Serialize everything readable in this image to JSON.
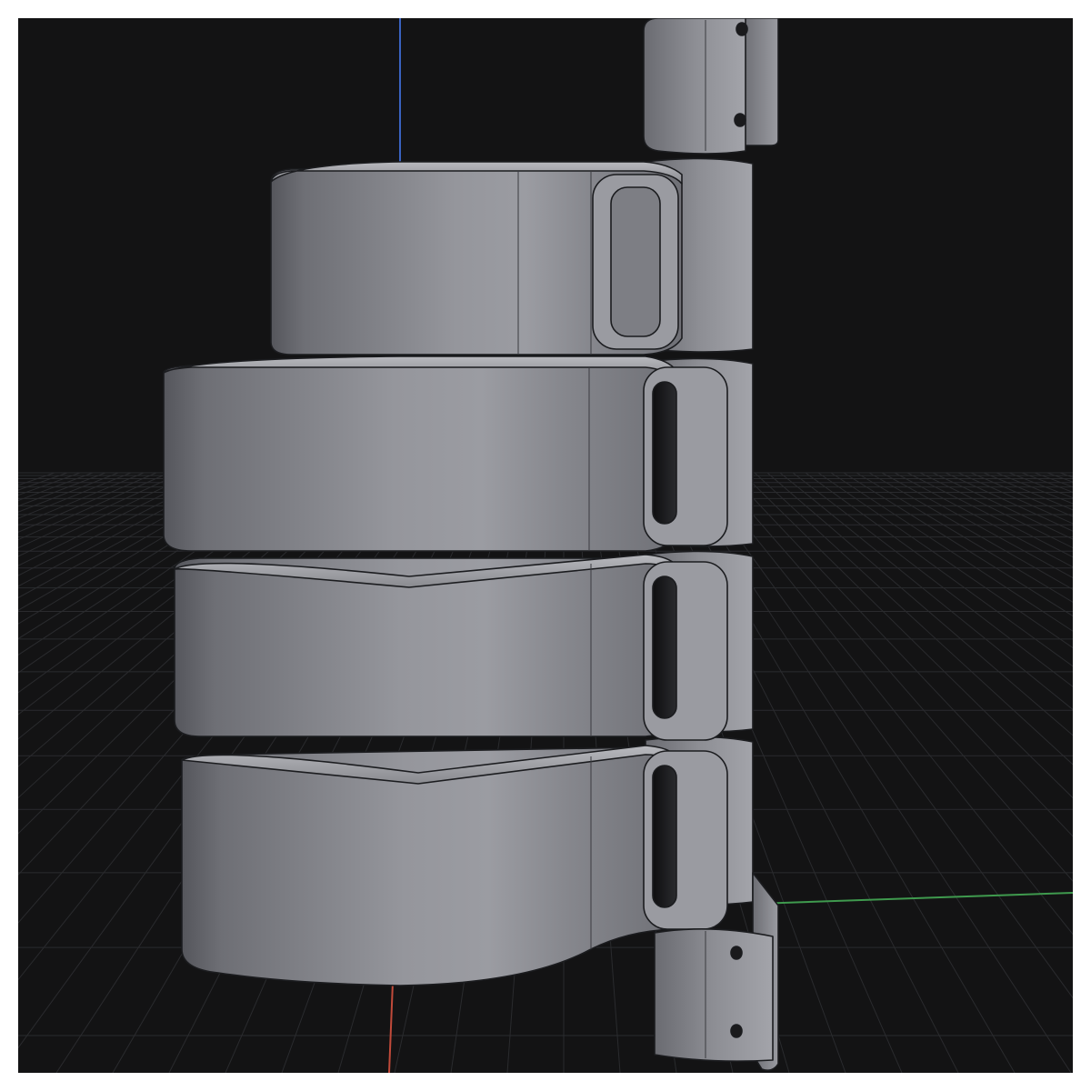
{
  "viewport": {
    "background_color": "#131314",
    "grid_color": "#2a2b2e",
    "axis_colors": {
      "x": "#c14a3a",
      "y": "#3f9a4e",
      "z": "#3a63c2"
    }
  },
  "model": {
    "base_color": "#8e8f95",
    "edge_color": "#1b1c1f"
  }
}
